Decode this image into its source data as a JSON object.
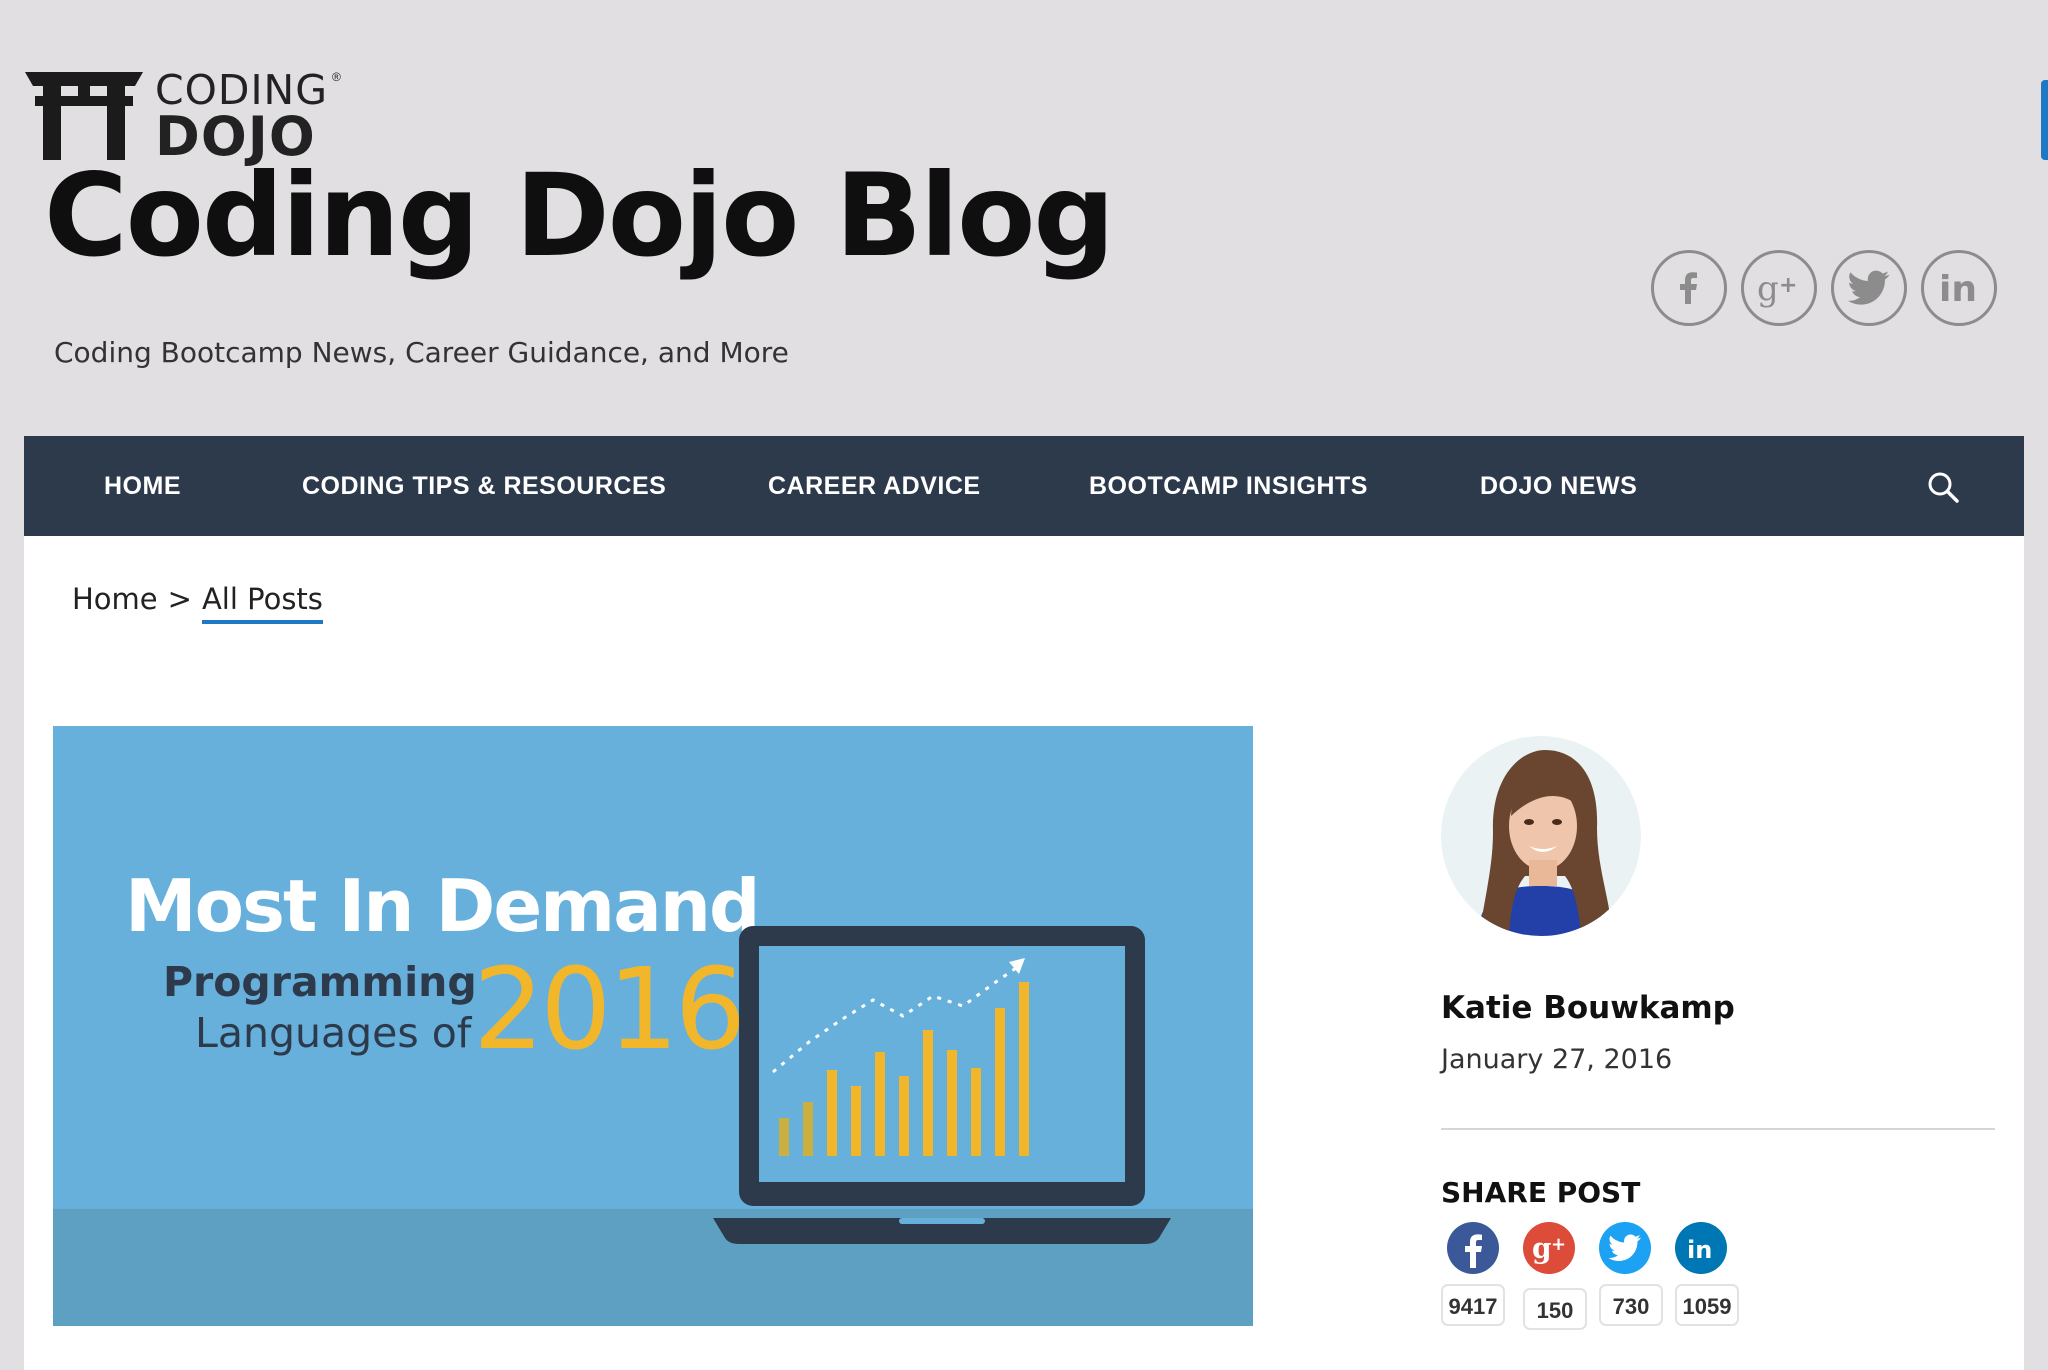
{
  "logo": {
    "line1": "CODING",
    "line2": "DOJO",
    "reg": "®"
  },
  "blog": {
    "title": "Coding Dojo Blog",
    "tagline": "Coding Bootcamp News, Career Guidance, and More"
  },
  "header_social": [
    {
      "icon": "facebook-icon"
    },
    {
      "icon": "google-plus-icon"
    },
    {
      "icon": "twitter-icon"
    },
    {
      "icon": "linkedin-icon"
    }
  ],
  "nav": {
    "items": [
      {
        "label": "HOME"
      },
      {
        "label": "CODING TIPS & RESOURCES"
      },
      {
        "label": "CAREER ADVICE"
      },
      {
        "label": "BOOTCAMP INSIGHTS"
      },
      {
        "label": "DOJO NEWS"
      }
    ],
    "search_icon": "search-icon"
  },
  "breadcrumb": {
    "home": "Home",
    "separator": ">",
    "current": "All Posts"
  },
  "hero": {
    "title": "Most In Demand",
    "line2": "Programming",
    "line3": "Languages of",
    "year": "2016"
  },
  "author": {
    "name": "Katie Bouwkamp",
    "date": "January 27, 2016"
  },
  "share": {
    "label": "SHARE POST",
    "buttons": [
      {
        "icon": "facebook-icon",
        "count": "9417",
        "color": "#3b5998"
      },
      {
        "icon": "google-plus-icon",
        "count": "150",
        "color": "#dd4b39"
      },
      {
        "icon": "twitter-icon",
        "count": "730",
        "color": "#1da1f2"
      },
      {
        "icon": "linkedin-icon",
        "count": "1059",
        "color": "#0077b5"
      }
    ]
  },
  "colors": {
    "navbar": "#2d3a4c",
    "accent": "#1f78c4",
    "hero_bg": "#67b0db",
    "hero_year": "#f2b62b"
  }
}
